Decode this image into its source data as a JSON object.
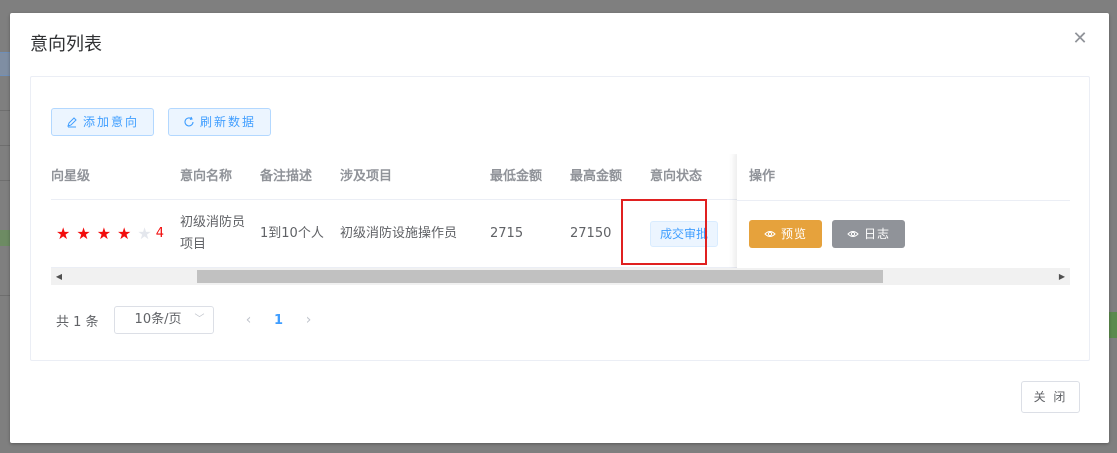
{
  "dialog": {
    "title": "意向列表",
    "close_glyph": "✕",
    "close_label": "关 闭"
  },
  "toolbar": {
    "add_label": "添加意向",
    "refresh_label": "刷新数据"
  },
  "table": {
    "columns": [
      "向星级",
      "意向名称",
      "备注描述",
      "涉及项目",
      "最低金额",
      "最高金额",
      "意向状态",
      "操作"
    ],
    "rows": [
      {
        "rating_value": 4,
        "rating_max": 5,
        "rating_text": "4",
        "name": "初级消防员项目",
        "description": "1到10个人",
        "project": "初级消防设施操作员",
        "min_amount": "2715",
        "max_amount": "27150",
        "status": "成交审批",
        "preview_label": "预览",
        "log_label": "日志"
      }
    ]
  },
  "pagination": {
    "total": "共 1 条",
    "page_size": "10条/页",
    "current_page": "1"
  },
  "colors": {
    "primary": "#409eff",
    "warning": "#e6a23c",
    "info": "#909399",
    "star": "#f20c0c",
    "highlight": "#e02020"
  }
}
